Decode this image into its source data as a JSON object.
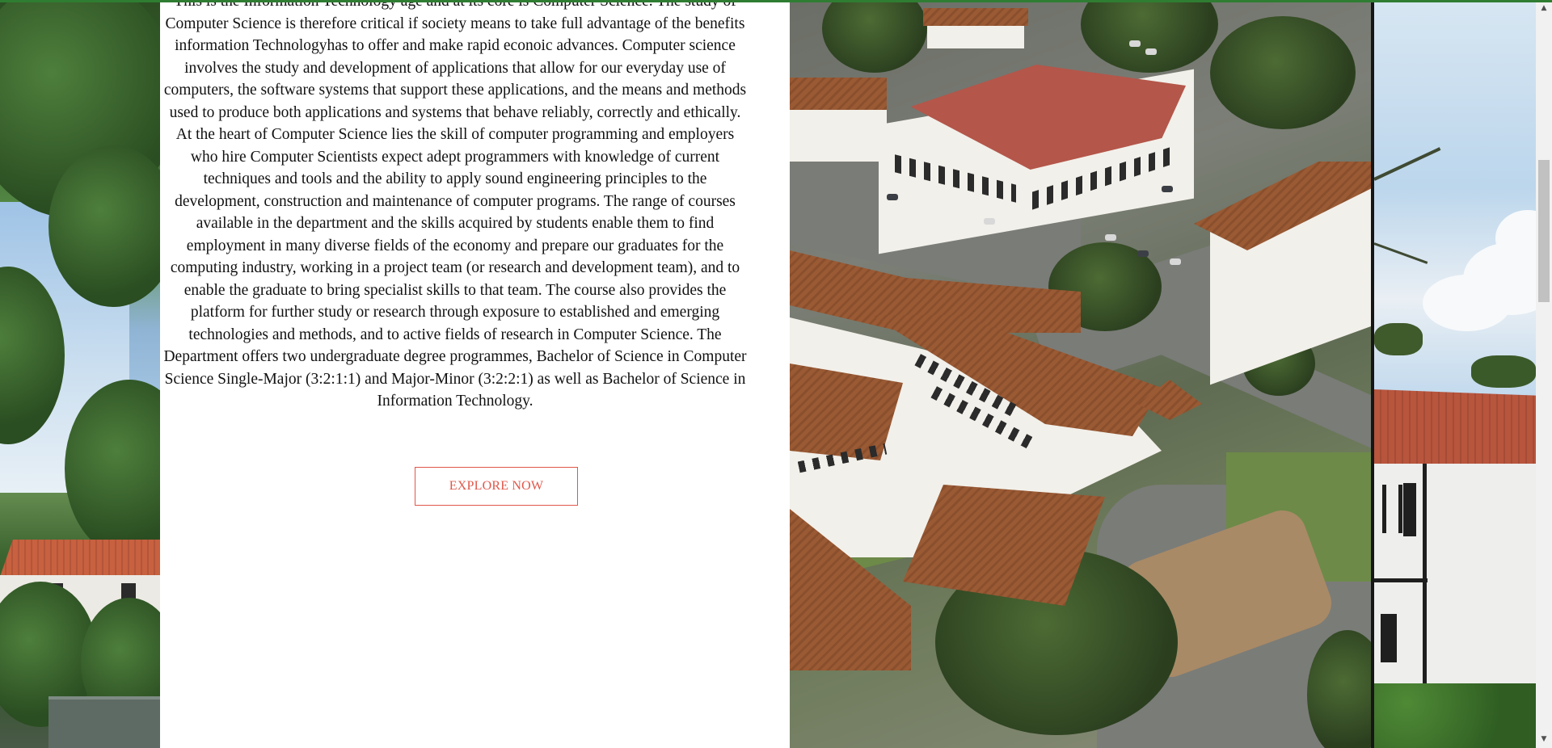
{
  "about": {
    "paragraph": "This is the Information Technology age and at its core is Computer Science. The study of Computer Science is therefore critical if society means to take full advantage of the benefits information Technologyhas to offer and make rapid econoic advances. Computer science involves the study and development of applications that allow for our everyday use of computers, the software systems that support these applications, and the means and methods used to produce both applications and systems that behave reliably, correctly and ethically. At the heart of Computer Science lies the skill of computer programming and employers who hire Computer Scientists expect adept programmers with knowledge of current techniques and tools and the ability to apply sound engineering principles to the development, construction and maintenance of computer programs. The range of courses available in the department and the skills acquired by students enable them to find employment in many diverse fields of the economy and prepare our graduates for the computing industry, working in a project team (or research and development team), and to enable the graduate to bring specialist skills to that team. The course also provides the platform for further study or research through exposure to established and emerging technologies and methods, and to active fields of research in Computer Science. The Department offers two undergraduate degree programmes, Bachelor of Science in Computer Science Single-Major (3:2:1:1) and Major-Minor (3:2:2:1) as well as Bachelor of Science in Information Technology.",
    "cta_label": "EXPLORE NOW"
  },
  "colors": {
    "accent": "#e0574a",
    "top_bar": "#2f7d32",
    "text": "#111111"
  },
  "scrollbar": {
    "up_icon": "scroll-up-arrow-icon",
    "down_icon": "scroll-down-arrow-icon"
  }
}
